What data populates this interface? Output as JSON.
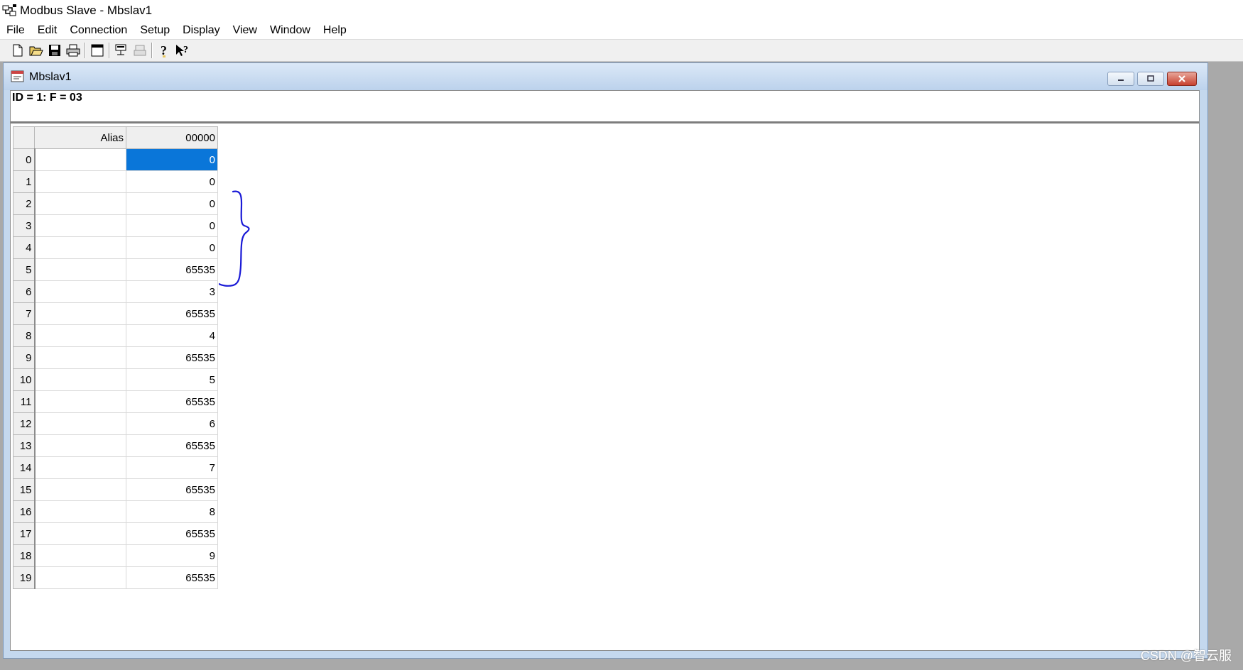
{
  "app": {
    "title": "Modbus Slave - Mbslav1"
  },
  "menu": [
    "File",
    "Edit",
    "Connection",
    "Setup",
    "Display",
    "View",
    "Window",
    "Help"
  ],
  "toolbar": {
    "buttons": [
      "new-icon",
      "open-icon",
      "save-icon",
      "print-icon",
      "window-icon",
      "connect-icon",
      "disconnect-icon",
      "help-icon",
      "context-help-icon"
    ]
  },
  "child_window": {
    "title": "Mbslav1",
    "info": "ID = 1: F = 03"
  },
  "grid": {
    "headers": {
      "alias": "Alias",
      "value": "00000"
    },
    "rows": [
      {
        "num": "0",
        "alias": "",
        "value": "0"
      },
      {
        "num": "1",
        "alias": "",
        "value": "0"
      },
      {
        "num": "2",
        "alias": "",
        "value": "0"
      },
      {
        "num": "3",
        "alias": "",
        "value": "0"
      },
      {
        "num": "4",
        "alias": "",
        "value": "0"
      },
      {
        "num": "5",
        "alias": "",
        "value": "65535"
      },
      {
        "num": "6",
        "alias": "",
        "value": "3"
      },
      {
        "num": "7",
        "alias": "",
        "value": "65535"
      },
      {
        "num": "8",
        "alias": "",
        "value": "4"
      },
      {
        "num": "9",
        "alias": "",
        "value": "65535"
      },
      {
        "num": "10",
        "alias": "",
        "value": "5"
      },
      {
        "num": "11",
        "alias": "",
        "value": "65535"
      },
      {
        "num": "12",
        "alias": "",
        "value": "6"
      },
      {
        "num": "13",
        "alias": "",
        "value": "65535"
      },
      {
        "num": "14",
        "alias": "",
        "value": "7"
      },
      {
        "num": "15",
        "alias": "",
        "value": "65535"
      },
      {
        "num": "16",
        "alias": "",
        "value": "8"
      },
      {
        "num": "17",
        "alias": "",
        "value": "65535"
      },
      {
        "num": "18",
        "alias": "",
        "value": "9"
      },
      {
        "num": "19",
        "alias": "",
        "value": "65535"
      }
    ],
    "selected_row": "0"
  },
  "colors": {
    "selection": "#0a76d9",
    "annotation": "#1a1ad6"
  },
  "watermark": "CSDN @智云服"
}
